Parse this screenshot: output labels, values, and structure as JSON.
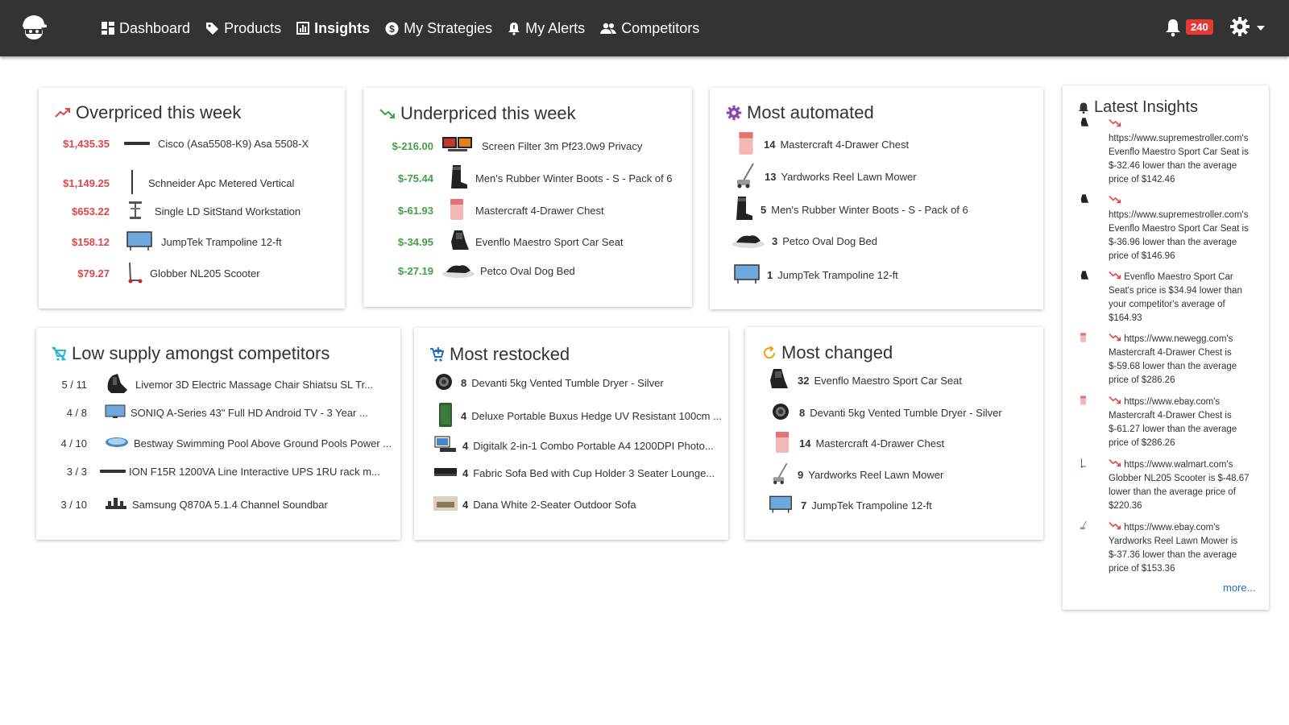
{
  "nav": {
    "items": [
      {
        "label": "Dashboard"
      },
      {
        "label": "Products"
      },
      {
        "label": "Insights"
      },
      {
        "label": "My Strategies"
      },
      {
        "label": "My Alerts"
      },
      {
        "label": "Competitors"
      }
    ],
    "notifications_count": "240"
  },
  "overpriced": {
    "title": "Overpriced this week",
    "rows": [
      {
        "price": "$1,435.35",
        "name": "Cisco (Asa5508-K9) Asa 5508-X"
      },
      {
        "price": "$1,149.25",
        "name": "Schneider Apc Metered Vertical"
      },
      {
        "price": "$653.22",
        "name": "Single LD SitStand Workstation"
      },
      {
        "price": "$158.12",
        "name": "JumpTek Trampoline 12-ft"
      },
      {
        "price": "$79.27",
        "name": "Globber NL205 Scooter"
      }
    ]
  },
  "underpriced": {
    "title": "Underpriced this week",
    "rows": [
      {
        "price": "$-216.00",
        "name": "Screen Filter 3m Pf23.0w9 Privacy"
      },
      {
        "price": "$-75.44",
        "name": "Men's Rubber Winter Boots - S - Pack of 6"
      },
      {
        "price": "$-61.93",
        "name": "Mastercraft 4-Drawer Chest"
      },
      {
        "price": "$-34.95",
        "name": "Evenflo Maestro Sport Car Seat"
      },
      {
        "price": "$-27.19",
        "name": "Petco Oval Dog Bed"
      }
    ]
  },
  "automated": {
    "title": "Most automated",
    "rows": [
      {
        "count": "14",
        "name": "Mastercraft 4-Drawer Chest"
      },
      {
        "count": "13",
        "name": "Yardworks Reel Lawn Mower"
      },
      {
        "count": "5",
        "name": "Men's Rubber Winter Boots - S - Pack of 6"
      },
      {
        "count": "3",
        "name": "Petco Oval Dog Bed"
      },
      {
        "count": "1",
        "name": "JumpTek Trampoline 12-ft"
      }
    ]
  },
  "low_supply": {
    "title": "Low supply amongst competitors",
    "rows": [
      {
        "ratio": "5 / 11",
        "name": "Livemor 3D Electric Massage Chair Shiatsu SL Tr..."
      },
      {
        "ratio": "4 / 8",
        "name": "SONIQ A-Series 43\" Full HD Android TV - 3 Year ..."
      },
      {
        "ratio": "4 / 10",
        "name": "Bestway Swimming Pool Above Ground Pools Power ..."
      },
      {
        "ratio": "3 / 3",
        "name": "ION F15R 1200VA Line Interactive UPS 1RU rack m..."
      },
      {
        "ratio": "3 / 10",
        "name": "Samsung Q870A 5.1.4 Channel Soundbar"
      }
    ]
  },
  "restocked": {
    "title": "Most restocked",
    "rows": [
      {
        "count": "8",
        "name": "Devanti 5kg Vented Tumble Dryer - Silver"
      },
      {
        "count": "4",
        "name": "Deluxe Portable Buxus Hedge UV Resistant 100cm ..."
      },
      {
        "count": "4",
        "name": "Digitalk 2-in-1 Combo Portable A4 1200DPI Photo..."
      },
      {
        "count": "4",
        "name": "Fabric Sofa Bed with Cup Holder 3 Seater Lounge..."
      },
      {
        "count": "4",
        "name": "Dana White 2-Seater Outdoor Sofa"
      }
    ]
  },
  "changed": {
    "title": "Most changed",
    "rows": [
      {
        "count": "32",
        "name": "Evenflo Maestro Sport Car Seat"
      },
      {
        "count": "8",
        "name": "Devanti 5kg Vented Tumble Dryer - Silver"
      },
      {
        "count": "14",
        "name": "Mastercraft 4-Drawer Chest"
      },
      {
        "count": "9",
        "name": "Yardworks Reel Lawn Mower"
      },
      {
        "count": "7",
        "name": "JumpTek Trampoline 12-ft"
      }
    ]
  },
  "latest": {
    "title": "Latest Insights",
    "items": [
      {
        "text": "https://www.supremestroller.com's Evenflo Maestro Sport Car Seat is $-32.46 lower than the average price of $142.46"
      },
      {
        "text": "https://www.supremestroller.com's Evenflo Maestro Sport Car Seat is $-36.96 lower than the average price of $146.96"
      },
      {
        "text": "Evenflo Maestro Sport Car Seat's price is $34.94 lower than your competitor's average of $164.93"
      },
      {
        "text": "https://www.newegg.com's Mastercraft 4-Drawer Chest is $-59.68 lower than the average price of $286.26"
      },
      {
        "text": "https://www.ebay.com's Mastercraft 4-Drawer Chest is $-61.27 lower than the average price of $286.26"
      },
      {
        "text": "https://www.walmart.com's Globber NL205 Scooter is $-48.67 lower than the average price of $220.36"
      },
      {
        "text": "https://www.ebay.com's Yardworks Reel Lawn Mower is $-37.36 lower than the average price of $153.36"
      }
    ],
    "more_label": "more..."
  },
  "colors": {
    "topbar": "#333333",
    "red": "#e04545",
    "green": "#43a047",
    "purple": "#8e44ad",
    "cyan": "#29b6d6",
    "orange": "#f39c12",
    "link": "#1e6fc9"
  }
}
